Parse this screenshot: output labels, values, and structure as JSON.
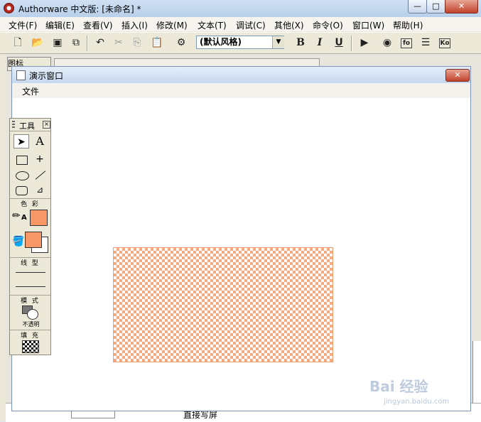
{
  "app": {
    "title": "Authorware 中文版: [未命名] *",
    "window_buttons": {
      "minimize": "—",
      "maximize": "□",
      "close": "✕"
    }
  },
  "menu": {
    "items": [
      "文件(F)",
      "编辑(E)",
      "查看(V)",
      "插入(I)",
      "修改(M)",
      "文本(T)",
      "调试(C)",
      "其他(X)",
      "命令(O)",
      "窗口(W)",
      "帮助(H)"
    ]
  },
  "toolbar": {
    "style_value": "(默认风格)",
    "bold": "B",
    "italic": "I",
    "underline": "U",
    "fo_label": "fo",
    "ko_label": "Ko"
  },
  "background": {
    "panel_tab": "图标",
    "bottom_text": "直接写屏"
  },
  "presentation": {
    "title": "演示窗口",
    "close": "✕",
    "menu_file": "文件"
  },
  "tools_palette": {
    "title": "工具",
    "close": "⊠",
    "text_tool": "A",
    "color_label": "色 彩",
    "line_label": "线 型",
    "mode_label": "模 式",
    "mode_value": "不透明",
    "fill_label": "填 充",
    "colors": {
      "fill": "#f79767",
      "checker": "#f7a97f"
    }
  },
  "watermark": {
    "text": "Bai 经验",
    "sub": "jingyan.baidu.com"
  }
}
